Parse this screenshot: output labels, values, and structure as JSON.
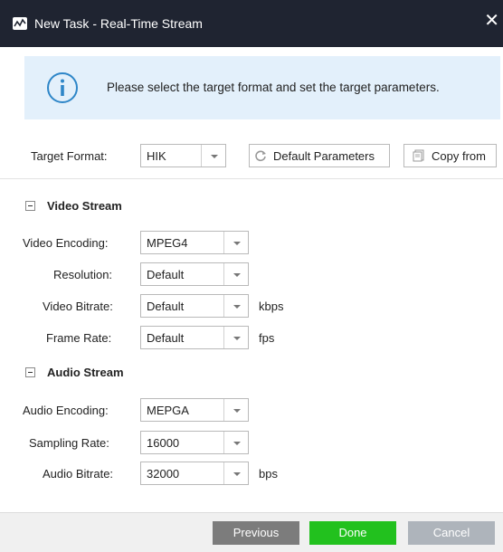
{
  "window": {
    "title": "New Task - Real-Time Stream",
    "close_glyph": "✕"
  },
  "info": {
    "icon": "info-circle-icon",
    "text": "Please select the target format and set the target parameters."
  },
  "target": {
    "label": "Target Format:",
    "value": "HIK",
    "default_params_label": "Default Parameters",
    "copy_from_label": "Copy from"
  },
  "video": {
    "header": "Video Stream",
    "encoding_label": "Video Encoding:",
    "encoding_value": "MPEG4",
    "resolution_label": "Resolution:",
    "resolution_value": "Default",
    "bitrate_label": "Video Bitrate:",
    "bitrate_value": "Default",
    "bitrate_unit": "kbps",
    "framerate_label": "Frame Rate:",
    "framerate_value": "Default",
    "framerate_unit": "fps"
  },
  "audio": {
    "header": "Audio Stream",
    "encoding_label": "Audio Encoding:",
    "encoding_value": "MEPGA",
    "sampling_label": "Sampling Rate:",
    "sampling_value": "16000",
    "bitrate_label": "Audio Bitrate:",
    "bitrate_value": "32000",
    "bitrate_unit": "bps"
  },
  "footer": {
    "previous_label": "Previous",
    "done_label": "Done",
    "cancel_label": "Cancel"
  },
  "colors": {
    "titlebar": "#1f2431",
    "info_bg": "#e3f0fb",
    "info_icon": "#2e86c8",
    "previous_btn": "#7c7c7c",
    "done_btn": "#22c11e",
    "cancel_btn": "#aeb4bb"
  }
}
